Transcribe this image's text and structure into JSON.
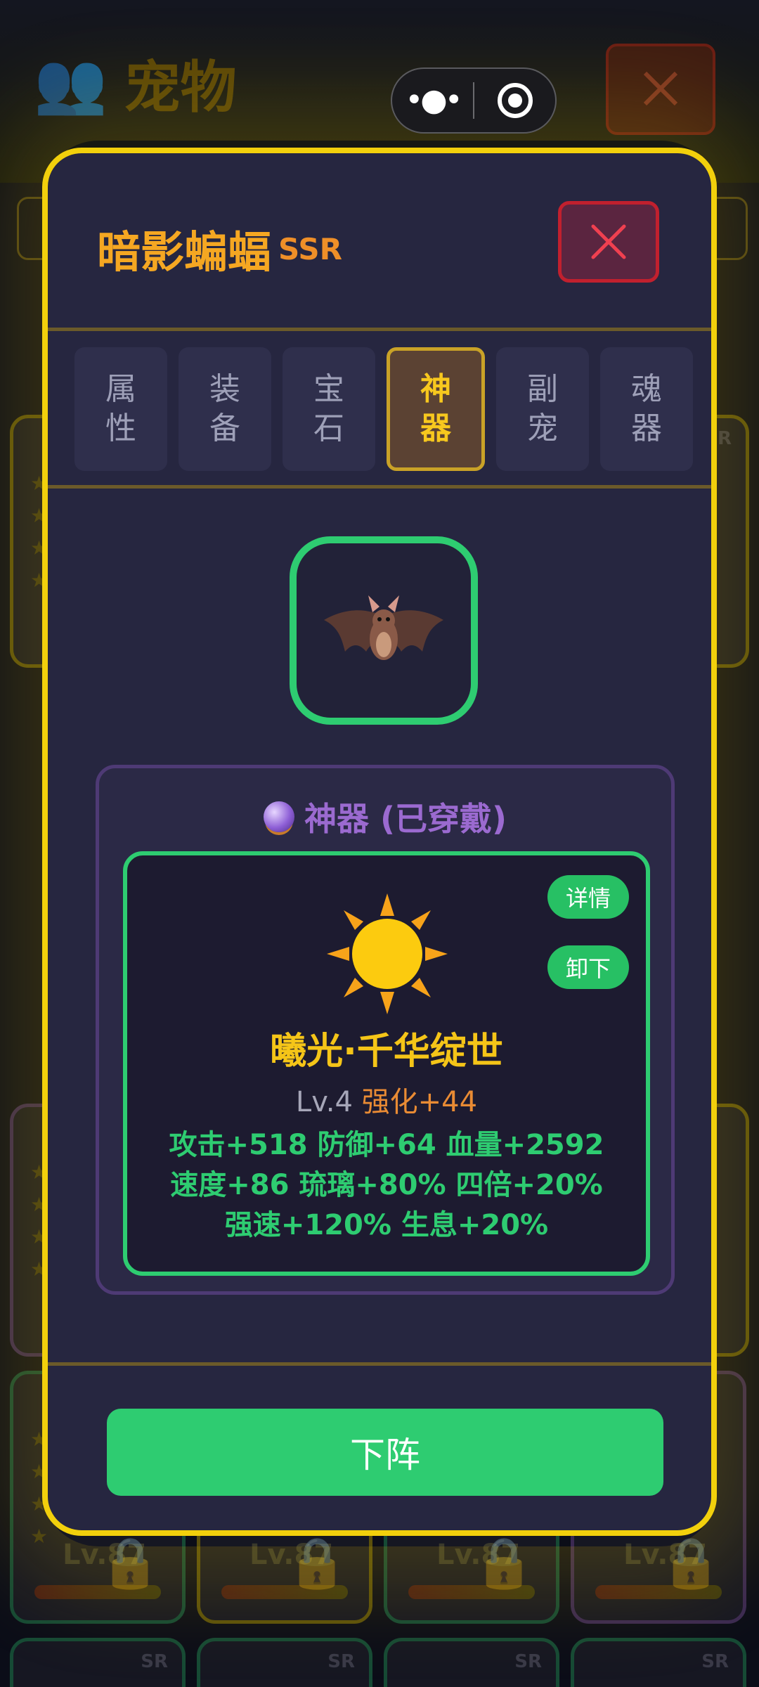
{
  "background": {
    "title_icon": "people-icon",
    "title": "宠物",
    "close_icon": "close-icon",
    "card_level": "Lv.87",
    "card_rarity": "SR"
  },
  "capsule": {
    "more_icon": "more-dots-icon",
    "exit_icon": "target-circle-icon"
  },
  "modal": {
    "pet_name": "暗影蝙蝠",
    "pet_rarity": "SSR",
    "close_icon": "close-icon",
    "tabs": [
      {
        "label": "属性",
        "active": false
      },
      {
        "label": "装备",
        "active": false
      },
      {
        "label": "宝石",
        "active": false
      },
      {
        "label": "神器",
        "active": true
      },
      {
        "label": "副宠",
        "active": false
      },
      {
        "label": "魂器",
        "active": false
      }
    ],
    "avatar_icon": "bat-icon",
    "artifact_panel": {
      "title_icon": "crystal-ball-icon",
      "title": "神器 (已穿戴)",
      "detail_button": "详情",
      "unequip_button": "卸下",
      "artifact_icon": "sun-icon",
      "artifact_name": "曦光·千华绽世",
      "level": "Lv.4",
      "enhance": "强化+44",
      "stats": "攻击+518 防御+64 血量+2592 速度+86 琉璃+80% 四倍+20% 强速+120% 生息+20%"
    },
    "deploy_button": "下阵"
  },
  "colors": {
    "modal_border": "#f2d00c",
    "accent_green": "#2ecc71",
    "pet_name": "#f5a722",
    "artifact_name": "#f5c518",
    "close_red": "#c1202e"
  }
}
